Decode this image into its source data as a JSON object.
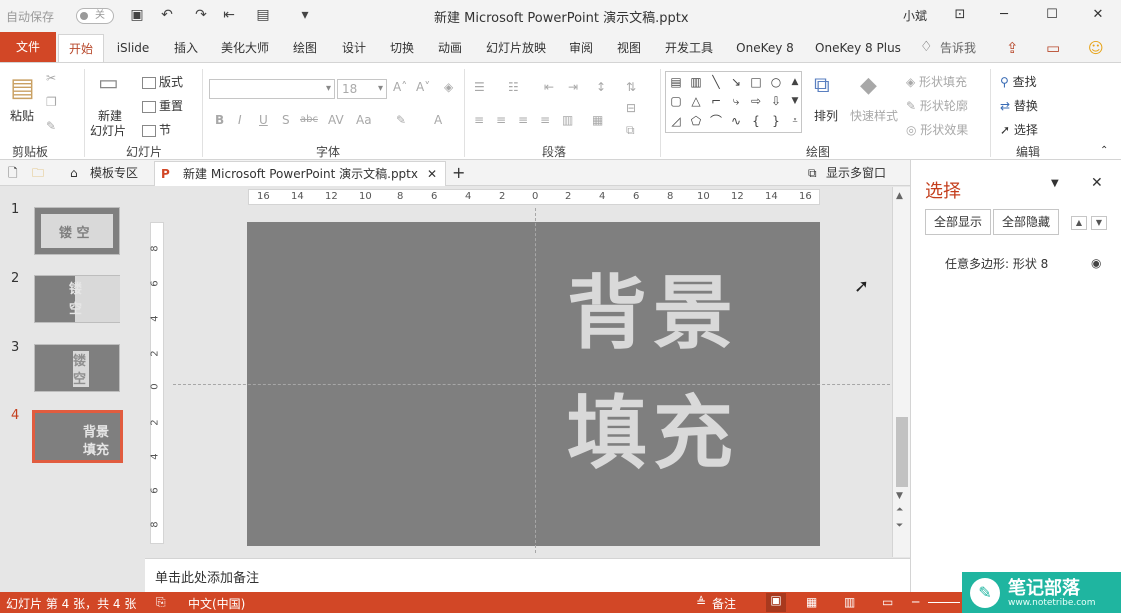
{
  "titlebar": {
    "autosave_label": "自动保存",
    "autosave_toggle": "关",
    "title": "新建 Microsoft PowerPoint 演示文稿.pptx",
    "user": "小斌"
  },
  "tabs": [
    "文件",
    "开始",
    "iSlide",
    "插入",
    "美化大师",
    "绘图",
    "设计",
    "切换",
    "动画",
    "幻灯片放映",
    "审阅",
    "视图",
    "开发工具",
    "OneKey 8",
    "OneKey 8 Plus",
    "告诉我"
  ],
  "ribbon": {
    "clipboard": {
      "paste": "粘贴",
      "group": "剪贴板"
    },
    "slides": {
      "new_slide_line1": "新建",
      "new_slide_line2": "幻灯片",
      "layout": "版式",
      "reset": "重置",
      "section": "节",
      "group": "幻灯片"
    },
    "font": {
      "size": "18",
      "group": "字体"
    },
    "paragraph": {
      "group": "段落"
    },
    "drawing": {
      "arrange": "排列",
      "quick_styles": "快速样式",
      "shape_fill": "形状填充",
      "shape_outline": "形状轮廓",
      "shape_effects": "形状效果",
      "group": "绘图"
    },
    "editing": {
      "find": "查找",
      "replace": "替换",
      "select": "选择",
      "group": "编辑"
    }
  },
  "docbar": {
    "template_tab": "模板专区",
    "doc_tab": "新建 Microsoft PowerPoint 演示文稿.pptx",
    "multi_window": "显示多窗口"
  },
  "thumbnails": [
    {
      "num": "1",
      "line1": "镂 空",
      "line2": ""
    },
    {
      "num": "2",
      "line1": "镂",
      "line2": "空"
    },
    {
      "num": "3",
      "line1": "镂",
      "line2": "空"
    },
    {
      "num": "4",
      "line1": "背景",
      "line2": "填充"
    }
  ],
  "ruler_h": [
    "16",
    "14",
    "12",
    "10",
    "8",
    "6",
    "4",
    "2",
    "0",
    "2",
    "4",
    "6",
    "8",
    "10",
    "12",
    "14",
    "16"
  ],
  "ruler_v": [
    "8",
    "6",
    "4",
    "2",
    "0",
    "2",
    "4",
    "6",
    "8"
  ],
  "slide": {
    "line1": "背景",
    "line2": "填充"
  },
  "notes_placeholder": "单击此处添加备注",
  "selection_pane": {
    "title": "选择",
    "show_all": "全部显示",
    "hide_all": "全部隐藏",
    "item": "任意多边形: 形状 8"
  },
  "status": {
    "slide_info": "幻灯片 第 4 张，共 4 张",
    "language": "中文(中国)",
    "notes": "备注"
  },
  "watermark": {
    "title": "笔记部落",
    "url": "www.notetribe.com"
  },
  "colors": {
    "accent": "#d24726",
    "slide_bg": "#7f7f7f",
    "slide_text": "#d9d9d9"
  }
}
